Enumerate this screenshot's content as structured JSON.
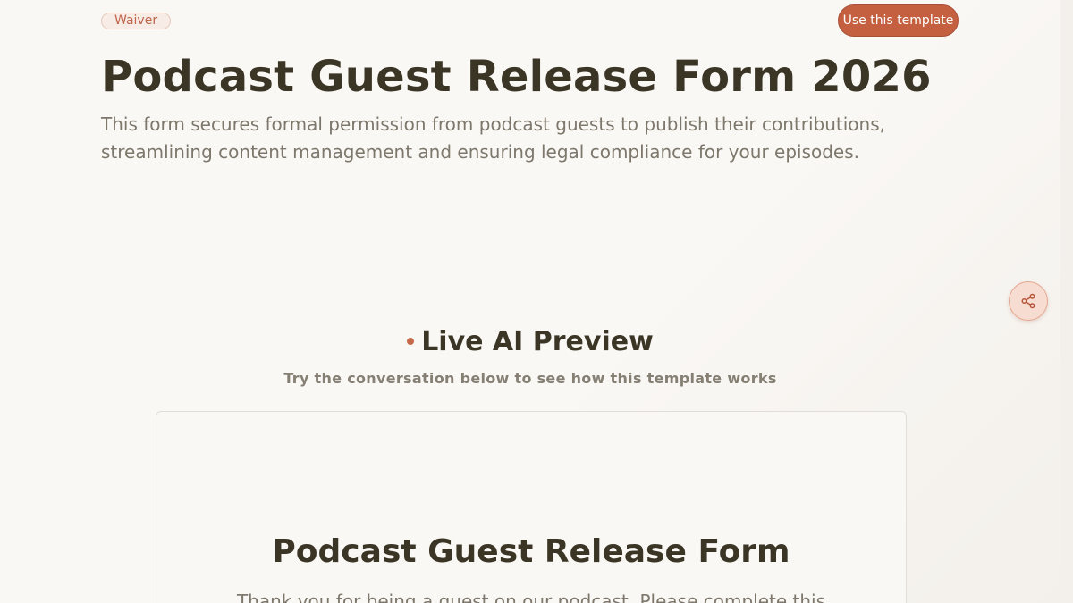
{
  "header": {
    "tag": "Waiver",
    "cta_label": "Use this template",
    "title": "Podcast Guest Release Form 2026",
    "subtitle": "This form secures formal permission from podcast guests to publish their contributions, streamlining content management and ensuring legal compliance for your episodes."
  },
  "share": {
    "icon": "share-icon"
  },
  "preview": {
    "title": "Live AI Preview",
    "subtitle": "Try the conversation below to see how this template works",
    "form_title": "Podcast Guest Release Form",
    "form_intro": "Thank you for being a guest on our podcast. Please complete this"
  },
  "colors": {
    "accent": "#c4603f",
    "heading": "#3b3526",
    "muted": "#7d776c",
    "background": "#faf8f5"
  }
}
